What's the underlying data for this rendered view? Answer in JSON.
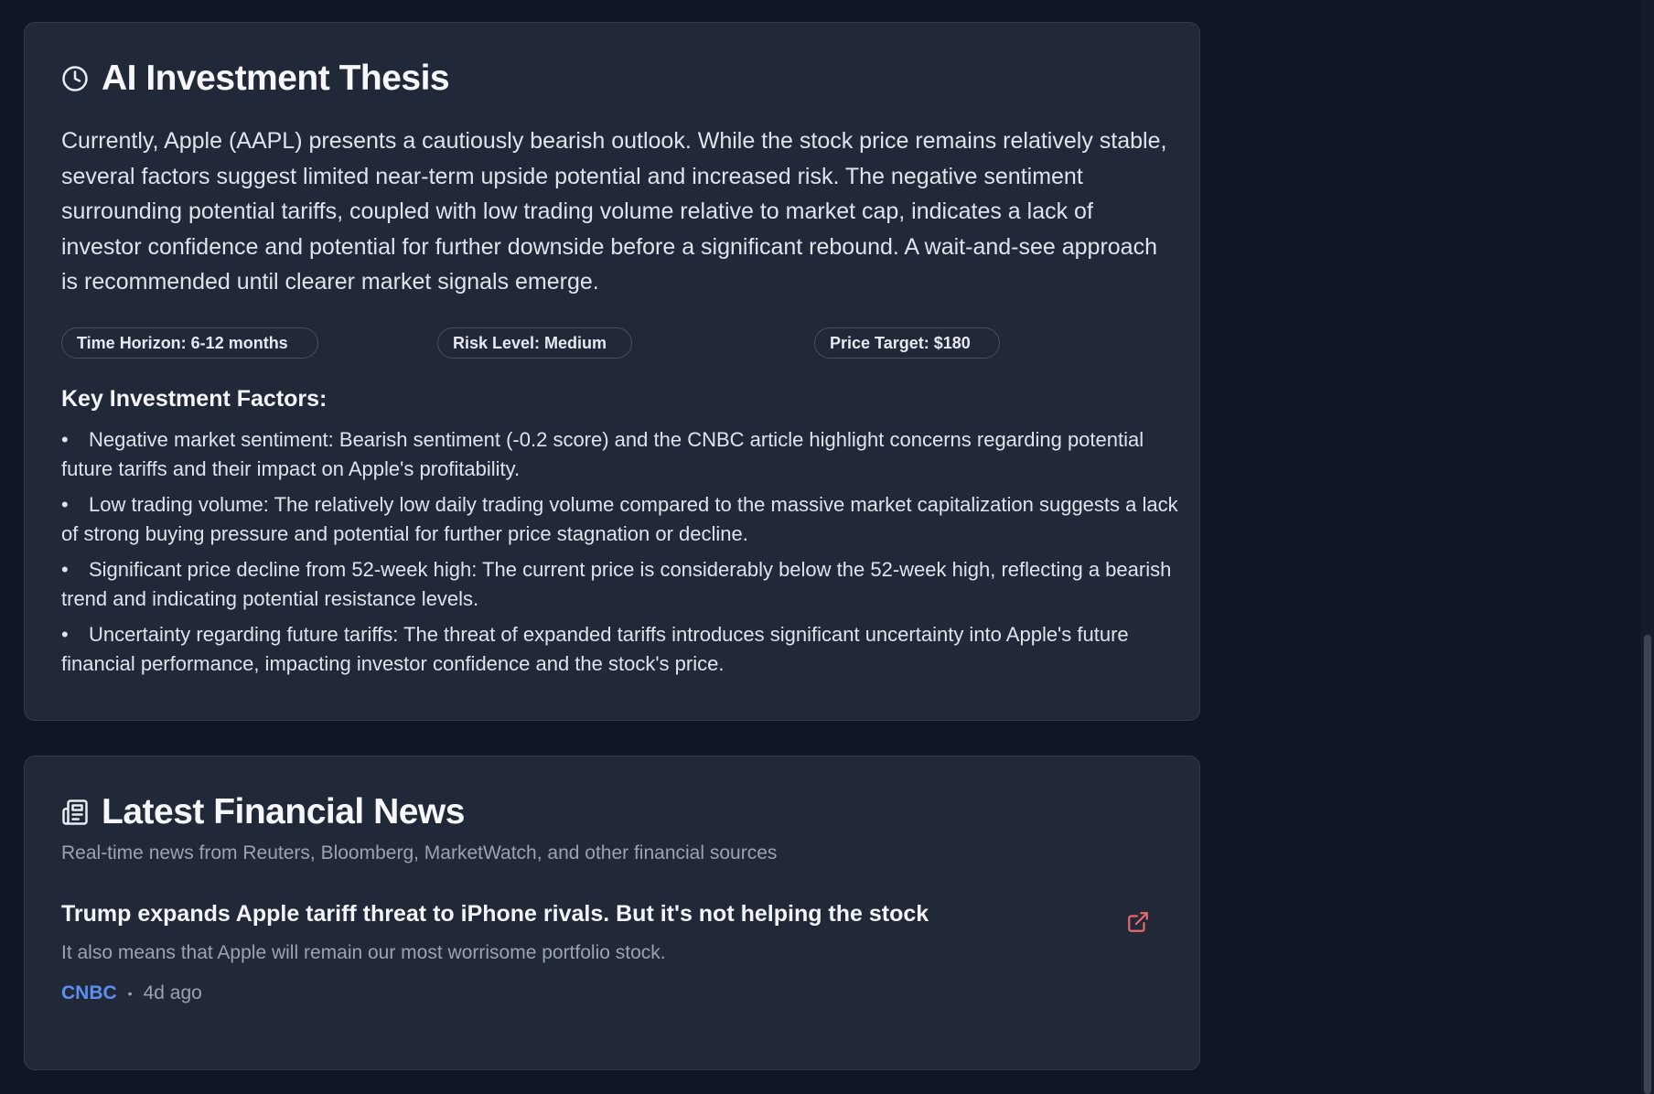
{
  "thesis": {
    "icon": "clock-icon",
    "title": "AI Investment Thesis",
    "summary": "Currently, Apple (AAPL) presents a cautiously bearish outlook. While the stock price remains relatively stable, several factors suggest limited near-term upside potential and increased risk. The negative sentiment surrounding potential tariffs, coupled with low trading volume relative to market cap, indicates a lack of investor confidence and potential for further downside before a significant rebound. A wait-and-see approach is recommended until clearer market signals emerge.",
    "pills": {
      "time_horizon": "Time Horizon: 6-12 months",
      "risk_level": "Risk Level: Medium",
      "price_target": "Price Target: $180"
    },
    "factors_heading": "Key Investment Factors:",
    "factors": [
      "Negative market sentiment: Bearish sentiment (-0.2 score) and the CNBC article highlight concerns regarding potential future tariffs and their impact on Apple's profitability.",
      "Low trading volume: The relatively low daily trading volume compared to the massive market capitalization suggests a lack of strong buying pressure and potential for further price stagnation or decline.",
      "Significant price decline from 52-week high: The current price is considerably below the 52-week high, reflecting a bearish trend and indicating potential resistance levels.",
      "Uncertainty regarding future tariffs: The threat of expanded tariffs introduces significant uncertainty into Apple's future financial performance, impacting investor confidence and the stock's price."
    ]
  },
  "news": {
    "icon": "newspaper-icon",
    "title": "Latest Financial News",
    "subtitle": "Real-time news from Reuters, Bloomberg, MarketWatch, and other financial sources",
    "items": [
      {
        "headline": "Trump expands Apple tariff threat to iPhone rivals. But it's not helping the stock",
        "summary": "It also means that Apple will remain our most worrisome portfolio stock.",
        "source": "CNBC",
        "separator": "•",
        "time": "4d ago",
        "link_icon": "external-link-icon"
      }
    ]
  },
  "colors": {
    "background": "#0f1626",
    "card": "#212939",
    "source_link": "#5e8fee",
    "external_link_icon": "#e86a6a"
  }
}
